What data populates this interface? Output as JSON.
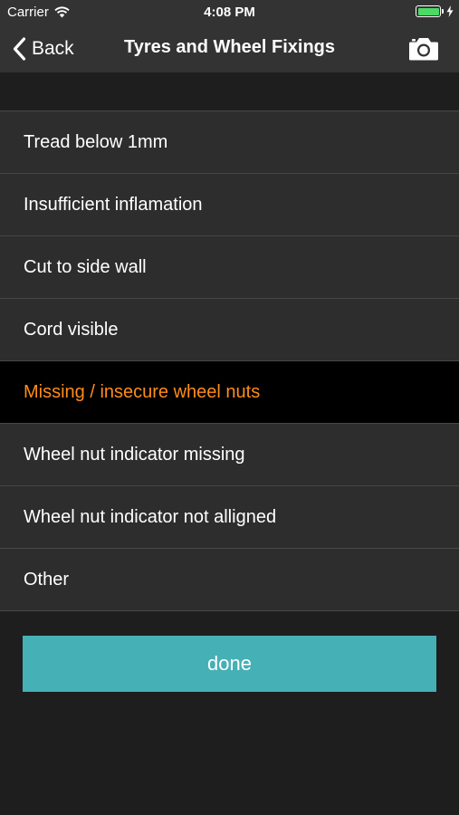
{
  "status_bar": {
    "carrier": "Carrier",
    "time": "4:08 PM",
    "battery_color": "#4cd964"
  },
  "nav": {
    "back_label": "Back",
    "title": "Tyres and Wheel Fixings",
    "camera_icon": "camera-icon"
  },
  "list": {
    "items": [
      {
        "label": "Tread below 1mm",
        "selected": false
      },
      {
        "label": "Insufficient inflamation",
        "selected": false
      },
      {
        "label": "Cut to side wall",
        "selected": false
      },
      {
        "label": "Cord visible",
        "selected": false
      },
      {
        "label": "Missing / insecure wheel nuts",
        "selected": true
      },
      {
        "label": "Wheel nut indicator missing",
        "selected": false
      },
      {
        "label": "Wheel nut indicator not alligned",
        "selected": false
      },
      {
        "label": "Other",
        "selected": false
      }
    ],
    "selected_color": "#ff8c1a"
  },
  "actions": {
    "done_label": "done",
    "done_color": "#45b0b5"
  }
}
